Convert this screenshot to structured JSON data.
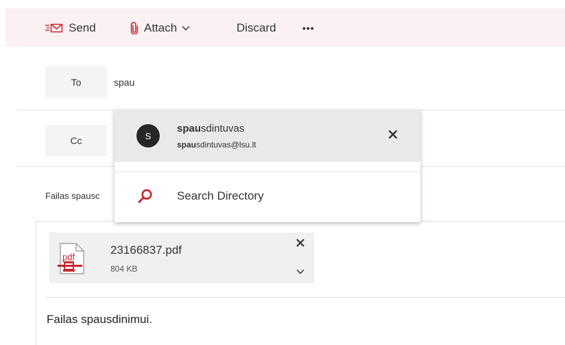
{
  "toolbar": {
    "send_label": "Send",
    "attach_label": "Attach",
    "discard_label": "Discard",
    "more_label": "•••"
  },
  "recipients": {
    "to_label": "To",
    "to_value": "spau",
    "cc_label": "Cc"
  },
  "subject": {
    "value_visible": "Failas spausc"
  },
  "suggestions": {
    "items": [
      {
        "initial": "S",
        "name_match": "spau",
        "name_rest": "sdintuvas",
        "email_match": "spau",
        "email_rest": "sdintuvas@lsu.lt"
      }
    ],
    "search_directory_label": "Search Directory"
  },
  "attachment": {
    "filename": "23166837.pdf",
    "size": "804 KB",
    "icon_text": "pdf"
  },
  "message": {
    "body": "Failas spausdinimui."
  },
  "colors": {
    "toolbar_bg": "#fbf1f2",
    "accent": "#c4262e",
    "avatar_bg": "#262626"
  },
  "icons": {
    "send": "send-icon",
    "attach": "paperclip-icon",
    "search": "search-icon",
    "pdf": "pdf-file-icon"
  }
}
